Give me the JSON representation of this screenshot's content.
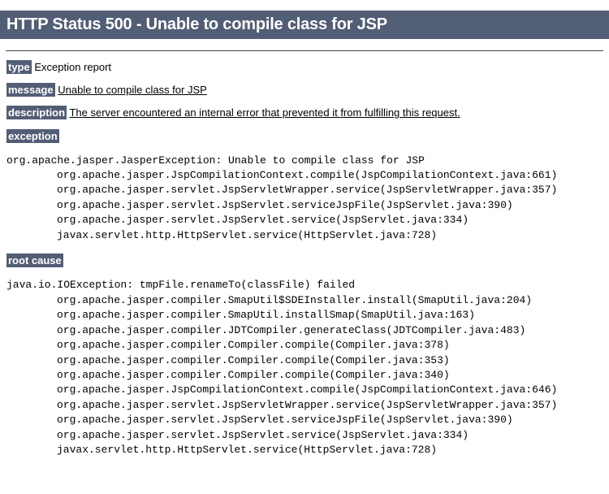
{
  "page": {
    "title": "HTTP Status 500 - Unable to compile class for JSP",
    "accent_color": "#525D76",
    "background_color": "#FFFFFF",
    "text_color": "#000000",
    "rule_color": "#3B4252"
  },
  "fields": [
    {
      "label": "type",
      "value": "Exception report",
      "underline": false
    },
    {
      "label": "message",
      "value": "Unable to compile class for JSP",
      "underline": true
    },
    {
      "label": "description",
      "value": "The server encountered an internal error that prevented it from fulfilling this request.",
      "underline": true
    }
  ],
  "sections": [
    {
      "label": "exception",
      "trace": [
        {
          "text": "org.apache.jasper.JasperException: Unable to compile class for JSP",
          "indent": false
        },
        {
          "text": "org.apache.jasper.JspCompilationContext.compile(JspCompilationContext.java:661)",
          "indent": true
        },
        {
          "text": "org.apache.jasper.servlet.JspServletWrapper.service(JspServletWrapper.java:357)",
          "indent": true
        },
        {
          "text": "org.apache.jasper.servlet.JspServlet.serviceJspFile(JspServlet.java:390)",
          "indent": true
        },
        {
          "text": "org.apache.jasper.servlet.JspServlet.service(JspServlet.java:334)",
          "indent": true
        },
        {
          "text": "javax.servlet.http.HttpServlet.service(HttpServlet.java:728)",
          "indent": true
        }
      ]
    },
    {
      "label": "root cause",
      "trace": [
        {
          "text": "java.io.IOException: tmpFile.renameTo(classFile) failed",
          "indent": false
        },
        {
          "text": "org.apache.jasper.compiler.SmapUtil$SDEInstaller.install(SmapUtil.java:204)",
          "indent": true
        },
        {
          "text": "org.apache.jasper.compiler.SmapUtil.installSmap(SmapUtil.java:163)",
          "indent": true
        },
        {
          "text": "org.apache.jasper.compiler.JDTCompiler.generateClass(JDTCompiler.java:483)",
          "indent": true
        },
        {
          "text": "org.apache.jasper.compiler.Compiler.compile(Compiler.java:378)",
          "indent": true
        },
        {
          "text": "org.apache.jasper.compiler.Compiler.compile(Compiler.java:353)",
          "indent": true
        },
        {
          "text": "org.apache.jasper.compiler.Compiler.compile(Compiler.java:340)",
          "indent": true
        },
        {
          "text": "org.apache.jasper.JspCompilationContext.compile(JspCompilationContext.java:646)",
          "indent": true
        },
        {
          "text": "org.apache.jasper.servlet.JspServletWrapper.service(JspServletWrapper.java:357)",
          "indent": true
        },
        {
          "text": "org.apache.jasper.servlet.JspServlet.serviceJspFile(JspServlet.java:390)",
          "indent": true
        },
        {
          "text": "org.apache.jasper.servlet.JspServlet.service(JspServlet.java:334)",
          "indent": true
        },
        {
          "text": "javax.servlet.http.HttpServlet.service(HttpServlet.java:728)",
          "indent": true
        }
      ]
    }
  ]
}
